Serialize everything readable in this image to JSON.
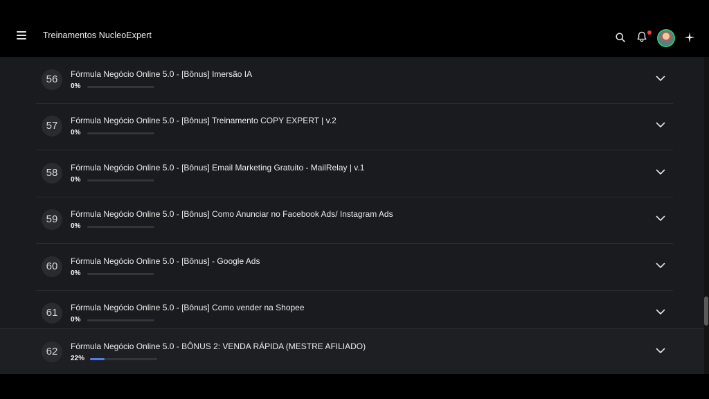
{
  "header": {
    "app_title": "Treinamentos NucleoExpert"
  },
  "modules": [
    {
      "number": "56",
      "title": "Fórmula Negócio Online 5.0 - [Bônus] Imersão IA",
      "progress_label": "0%",
      "progress": 0
    },
    {
      "number": "57",
      "title": "Fórmula Negócio Online 5.0 - [Bônus] Treinamento COPY EXPERT | v.2",
      "progress_label": "0%",
      "progress": 0
    },
    {
      "number": "58",
      "title": "Fórmula Negócio Online 5.0 - [Bônus] Email Marketing Gratuito - MailRelay | v.1",
      "progress_label": "0%",
      "progress": 0
    },
    {
      "number": "59",
      "title": "Fórmula Negócio Online 5.0 - [Bônus] Como Anunciar no Facebook Ads/ Instagram Ads",
      "progress_label": "0%",
      "progress": 0
    },
    {
      "number": "60",
      "title": "Fórmula Negócio Online 5.0 - [Bônus] - Google Ads",
      "progress_label": "0%",
      "progress": 0
    },
    {
      "number": "61",
      "title": "Fórmula Negócio Online 5.0 - [Bônus] Como vender na Shopee",
      "progress_label": "0%",
      "progress": 0
    },
    {
      "number": "62",
      "title": "Fórmula Negócio Online 5.0 - BÔNUS 2: VENDA RÁPIDA (MESTRE AFILIADO)",
      "progress_label": "22%",
      "progress": 22
    }
  ],
  "colors": {
    "accent": "#4a7cf3",
    "notification_dot": "#ff3b30",
    "avatar_ring": "#2ecc71"
  },
  "icons": [
    "menu-icon",
    "search-icon",
    "bell-icon",
    "avatar",
    "sparkle-icon",
    "chevron-down-icon"
  ]
}
